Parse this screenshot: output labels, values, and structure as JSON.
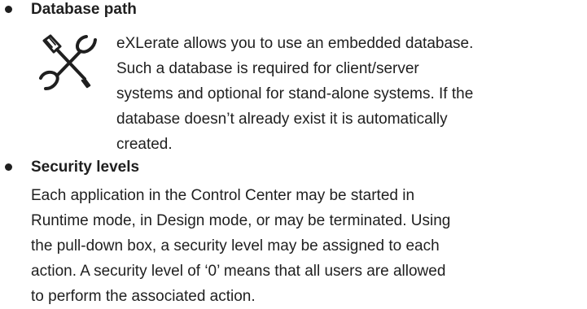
{
  "items": [
    {
      "heading": "Database path",
      "icon": "wrench-screwdriver-icon",
      "lines": [
        "eXLerate allows you to use an embedded database.",
        "Such a database is required for client/server",
        "systems and optional for stand-alone systems. If the",
        "database doesn’t already exist it is automatically",
        "created."
      ]
    },
    {
      "heading": "Security levels",
      "lines": [
        "Each application in the Control Center may be started in",
        "Runtime mode, in Design mode, or may be terminated. Using",
        "the pull-down box, a security level may be assigned to each",
        "action. A security level of ‘0’ means that all users are allowed",
        "to perform the associated action."
      ]
    }
  ]
}
